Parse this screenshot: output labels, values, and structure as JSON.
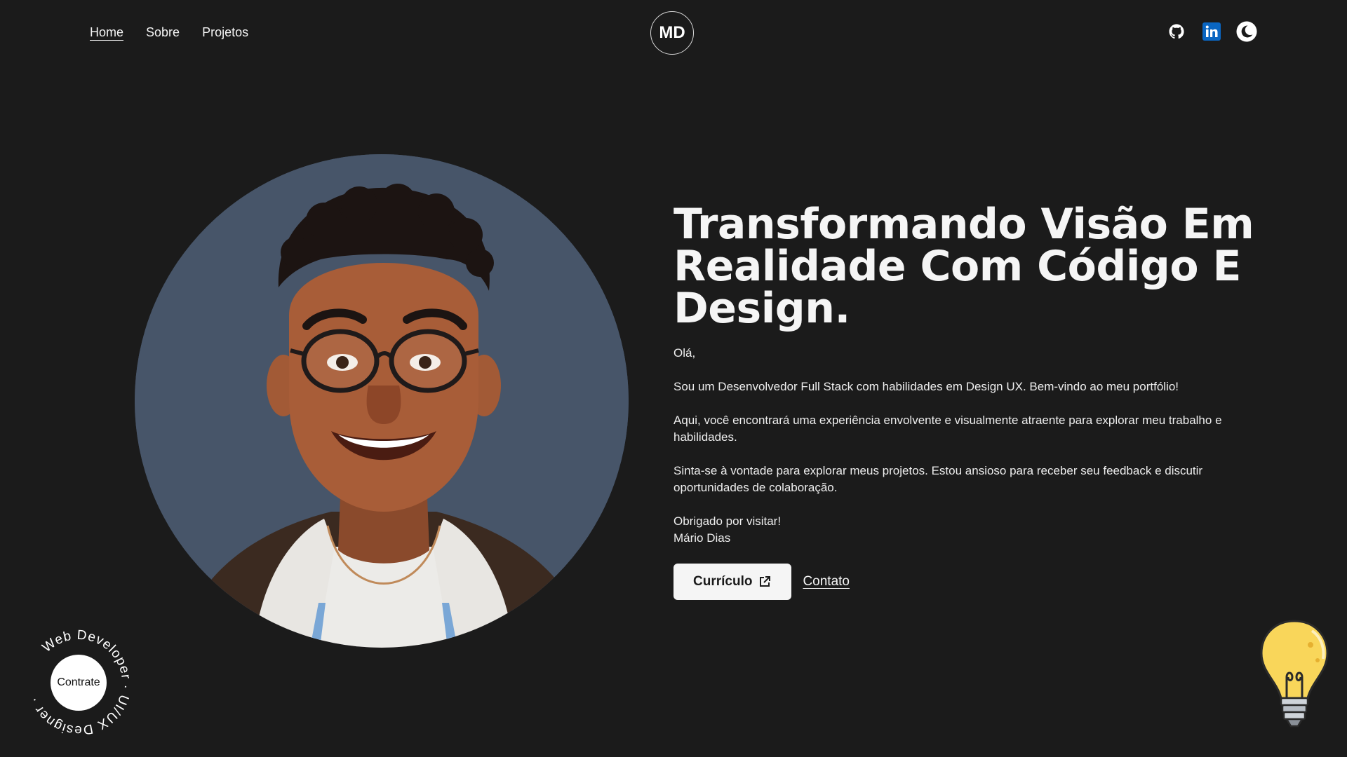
{
  "nav": {
    "links": [
      "Home",
      "Sobre",
      "Projetos"
    ],
    "logo": "MD",
    "social_icons": [
      "github-icon",
      "linkedin-icon",
      "theme-toggle-moon-icon"
    ]
  },
  "hero": {
    "title": "Transformando Visão Em Realidade Com Código E Design.",
    "greeting": "Olá,",
    "p1": "Sou um Desenvolvedor Full Stack com habilidades em Design UX. Bem-vindo ao meu portfólio!",
    "p2": "Aqui, você encontrará uma experiência envolvente e visualmente atraente para explorar meu trabalho e habilidades.",
    "p3": "Sinta-se à vontade para explorar meus projetos. Estou ansioso para receber seu feedback e discutir oportunidades de colaboração.",
    "thanks": "Obrigado por visitar!",
    "signature": "Mário Dias",
    "cv_label": "Currículo",
    "contact_label": "Contato"
  },
  "hire": {
    "label": "Contrate",
    "ring_text": "Web Developer · UI/UX Designer ·"
  },
  "colors": {
    "background": "#1b1b1b",
    "avatar_bg": "#475569",
    "text": "#f5f5f5",
    "linkedin": "#0a66c2",
    "bulb": "#f9d65a"
  }
}
